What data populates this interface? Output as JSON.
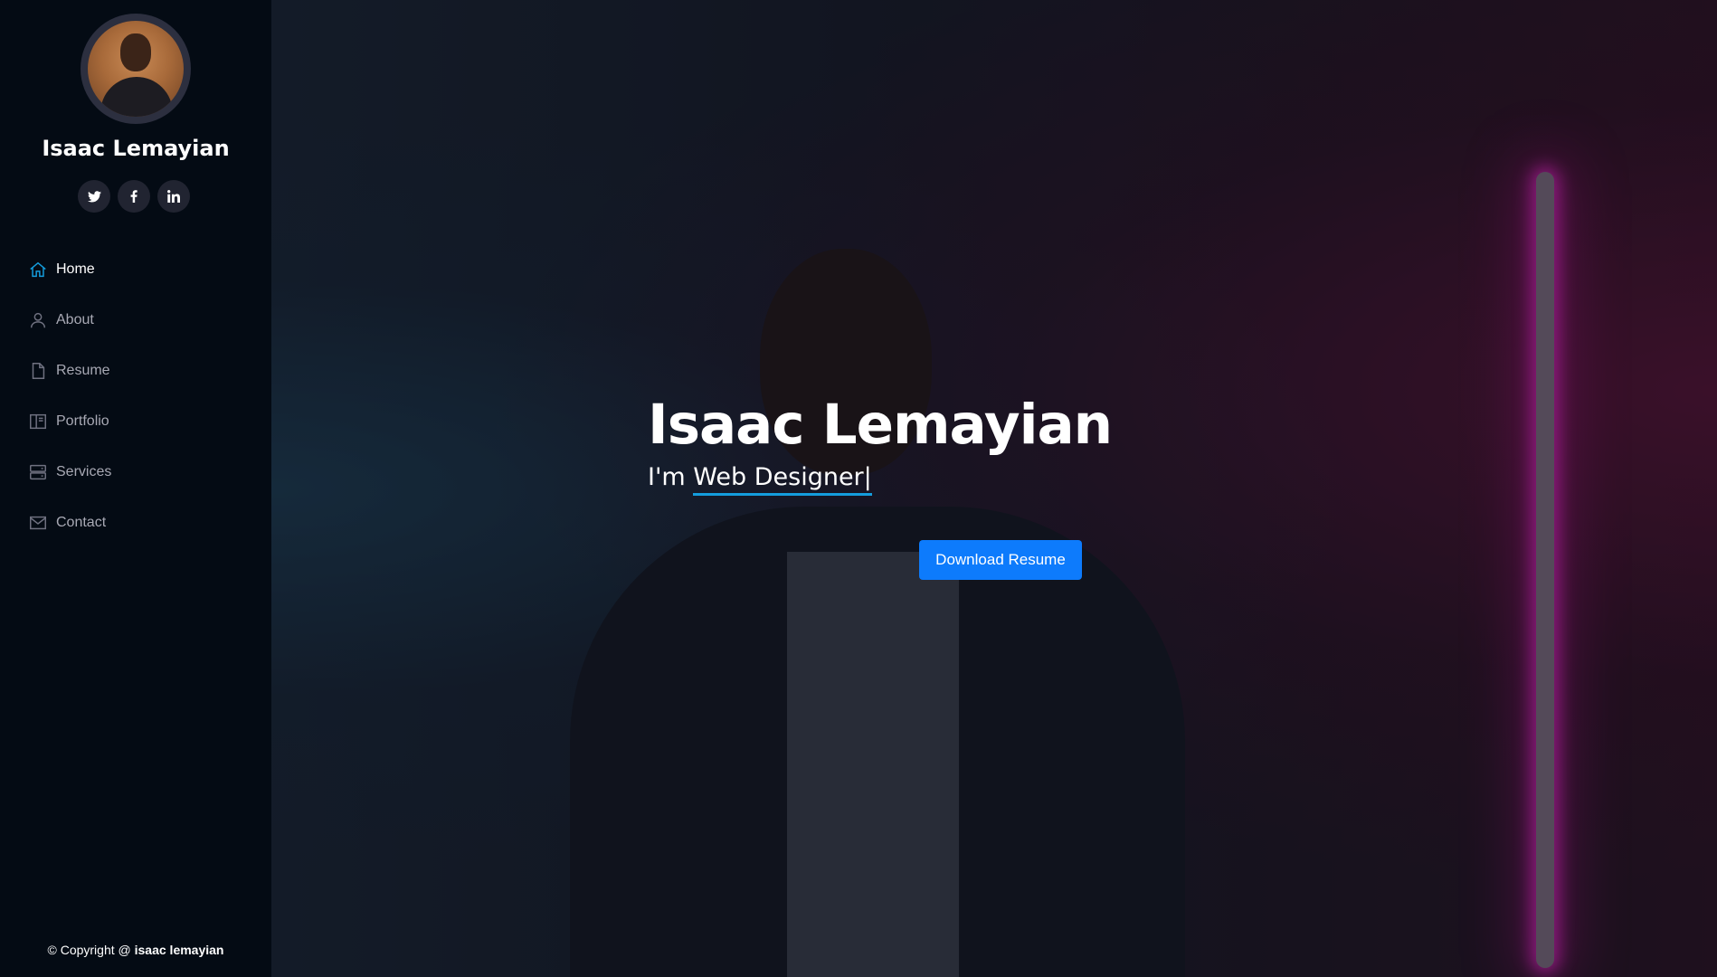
{
  "profile": {
    "name": "Isaac Lemayian",
    "socials": [
      {
        "icon": "twitter-icon",
        "glyph": "t"
      },
      {
        "icon": "facebook-icon",
        "glyph": "f"
      },
      {
        "icon": "linkedin-icon",
        "glyph": "in"
      }
    ]
  },
  "nav": {
    "items": [
      {
        "label": "Home",
        "icon": "home-icon",
        "active": true
      },
      {
        "label": "About",
        "icon": "user-icon",
        "active": false
      },
      {
        "label": "Resume",
        "icon": "file-icon",
        "active": false
      },
      {
        "label": "Portfolio",
        "icon": "book-icon",
        "active": false
      },
      {
        "label": "Services",
        "icon": "server-icon",
        "active": false
      },
      {
        "label": "Contact",
        "icon": "envelope-icon",
        "active": false
      }
    ]
  },
  "footer": {
    "prefix": "© Copyright @ ",
    "owner": "isaac lemayian"
  },
  "hero": {
    "title": "Isaac Lemayian",
    "prefix": "I'm ",
    "typed": "Web Designer",
    "cursor": "|",
    "cta_label": "Download Resume"
  },
  "colors": {
    "accent": "#149ddd",
    "cta": "#0d7bfc",
    "sidebar": "#040b14",
    "neon": "#e628c8"
  }
}
